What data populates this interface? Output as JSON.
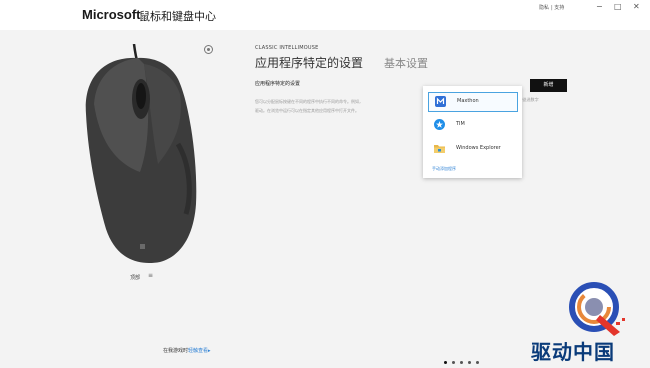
{
  "header": {
    "brand": "Microsoft",
    "app_name": "鼠标和键盘中心",
    "links": [
      "隐私",
      "支持"
    ],
    "window_controls": {
      "minimize": "−",
      "maximize": "□",
      "close": "✕"
    }
  },
  "device": {
    "caption": "顶部",
    "menu_glyph": "≡"
  },
  "settings": {
    "subtitle": "CLASSIC INTELLIMOUSE",
    "tab_active": "应用程序特定的设置",
    "tab_basic": "基本设置",
    "section_title": "应用程序特定的设置",
    "description_line1": "您可以分配鼠标按键在不同的程序中执行不同的命令。例如，",
    "description_line2": "驱动。在浏览中运行可以在指定其他应用程序中打开文件。",
    "description_tail": "oft 中迭选数字",
    "add_button": "新增"
  },
  "dropdown": {
    "items": [
      {
        "label": "Maxthon",
        "icon": "maxthon-icon",
        "color": "#2f6fd6",
        "selected": true
      },
      {
        "label": "TIM",
        "icon": "tim-icon",
        "color": "#1f8ee8",
        "selected": false
      },
      {
        "label": "Windows Explorer",
        "icon": "folder-icon",
        "color": "#e8b84a",
        "selected": false
      }
    ],
    "manual_add": "手动添加程序"
  },
  "footer": {
    "text": "在我游戏时",
    "link": "轻触查看",
    "link_suffix": "▸",
    "page_dots": 5,
    "active_dot": 0
  },
  "watermark": {
    "text": "驱动中国",
    "accent": "#e3352b",
    "brand_color": "#0a3b7a"
  }
}
